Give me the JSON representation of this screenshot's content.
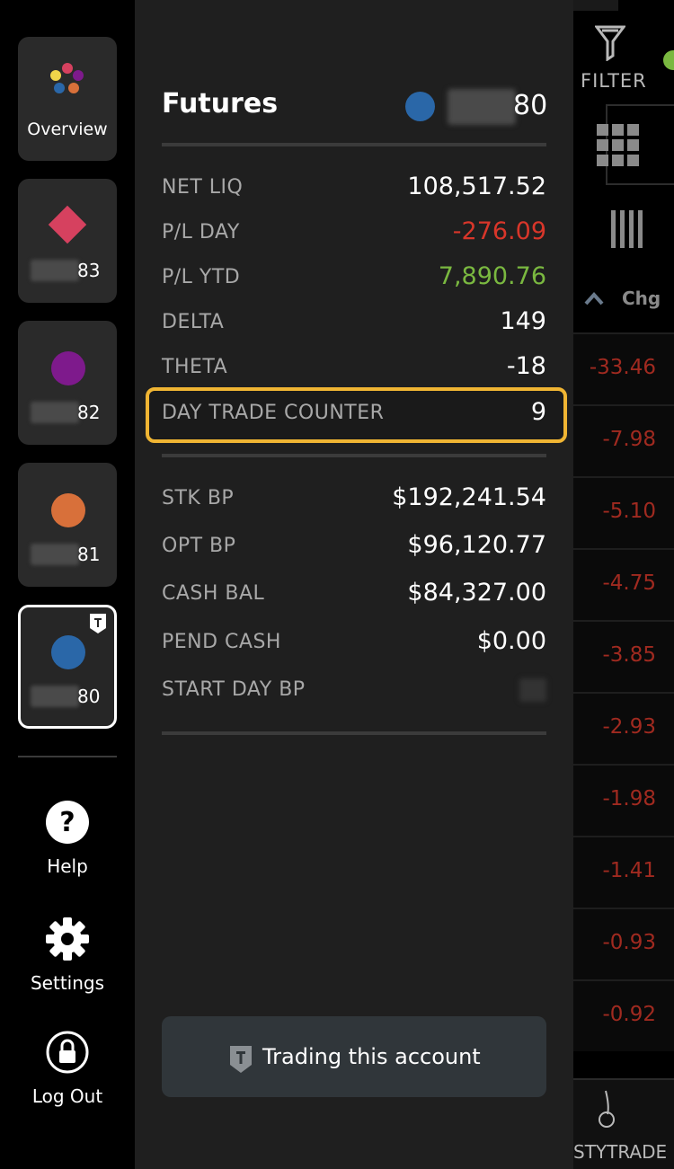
{
  "sidebar": {
    "overview_label": "Overview",
    "accounts": [
      {
        "suffix": "83",
        "color": "#d6415f",
        "shape": "diamond"
      },
      {
        "suffix": "82",
        "color": "#7e1a8c",
        "shape": "circle"
      },
      {
        "suffix": "81",
        "color": "#d8703a",
        "shape": "circle"
      },
      {
        "suffix": "80",
        "color": "#2a67a8",
        "shape": "circle",
        "selected": true,
        "badge_icon": "trading-shield-icon"
      }
    ],
    "help_label": "Help",
    "settings_label": "Settings",
    "logout_label": "Log Out"
  },
  "panel": {
    "title": "Futures",
    "account_suffix": "80",
    "account_color": "#2a67a8",
    "metrics": [
      {
        "label": "NET LIQ",
        "value": "108,517.52"
      },
      {
        "label": "P/L DAY",
        "value": "-276.09"
      },
      {
        "label": "P/L YTD",
        "value": "7,890.76"
      },
      {
        "label": "DELTA",
        "value": "149"
      },
      {
        "label": "THETA",
        "value": "-18"
      },
      {
        "label": "DAY TRADE COUNTER",
        "value": "9"
      }
    ],
    "buying_power": [
      {
        "label": "STK BP",
        "value": "$192,241.54"
      },
      {
        "label": "OPT BP",
        "value": "$96,120.77"
      },
      {
        "label": "CASH BAL",
        "value": "$84,327.00"
      },
      {
        "label": "PEND CASH",
        "value": "$0.00"
      },
      {
        "label": "START DAY BP",
        "value": ""
      }
    ],
    "trading_button_label": "Trading this account"
  },
  "right": {
    "filter_label": "FILTER",
    "chg_header": "Chg",
    "changes": [
      "-33.46",
      "-7.98",
      "-5.10",
      "-4.75",
      "-3.85",
      "-2.93",
      "-1.98",
      "-1.41",
      "-0.93",
      "-0.92"
    ],
    "bottom_label": "STYTRADE"
  },
  "colors": {
    "negative": "#d8362a",
    "positive": "#7ab840",
    "highlight": "#f0b533"
  }
}
